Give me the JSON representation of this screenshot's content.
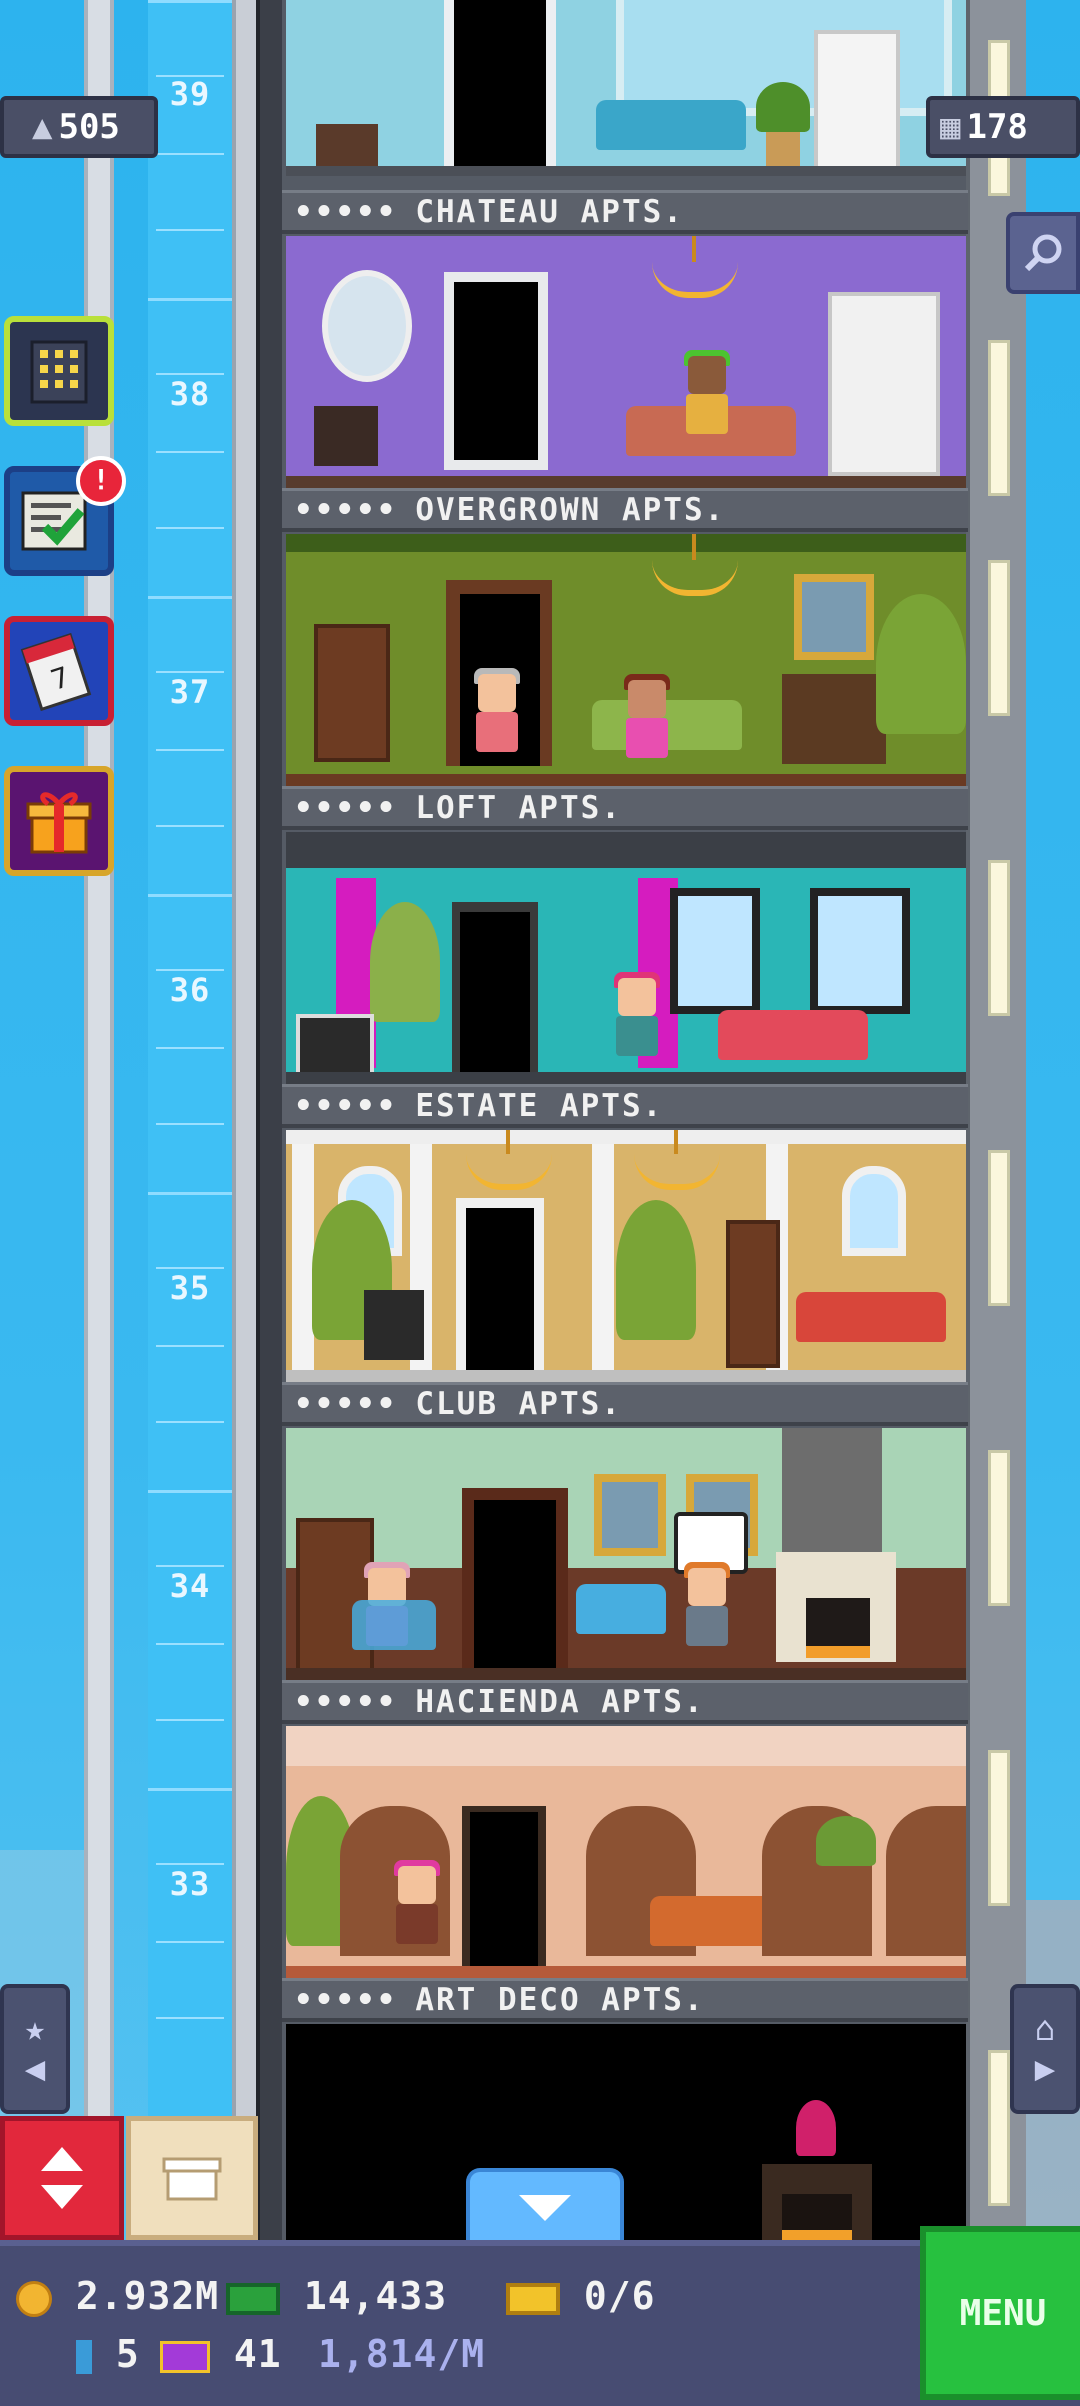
{
  "hud": {
    "population": "505",
    "floors": "178"
  },
  "elevator": {
    "floor_numbers": [
      "39",
      "38",
      "37",
      "36",
      "35",
      "34",
      "33"
    ]
  },
  "floors": [
    {
      "name": "CHATEAU APTS.",
      "rating": "•••••"
    },
    {
      "name": "OVERGROWN APTS.",
      "rating": "•••••"
    },
    {
      "name": "LOFT APTS.",
      "rating": "•••••"
    },
    {
      "name": "ESTATE APTS.",
      "rating": "•••••"
    },
    {
      "name": "CLUB APTS.",
      "rating": "•••••"
    },
    {
      "name": "HACIENDA APTS.",
      "rating": "•••••"
    },
    {
      "name": "ART DECO APTS.",
      "rating": "•••••"
    }
  ],
  "side_buttons": {
    "missions_badge": "!",
    "calendar_day": "7"
  },
  "bottom_bar": {
    "coins": "2.932M",
    "bux": "14,433",
    "tickets": "0/6",
    "items": "5",
    "vip": "41",
    "income_rate": "1,814/M",
    "menu_label": "MENU"
  },
  "colors": {
    "menu_green": "#27c13f",
    "hud_bg": "#474c72",
    "coin_gold": "#f2b531",
    "bux_green": "#2aa13c"
  },
  "icons": [
    "population-icon",
    "floors-icon",
    "search-icon",
    "build-icon",
    "missions-icon",
    "calendar-icon",
    "gift-icon",
    "elevator-up-down-icon",
    "storage-box-icon",
    "down-arrow-icon",
    "home-icon",
    "person-icon",
    "coin-icon",
    "bux-icon",
    "ticket-icon",
    "item-icon",
    "vip-icon"
  ]
}
